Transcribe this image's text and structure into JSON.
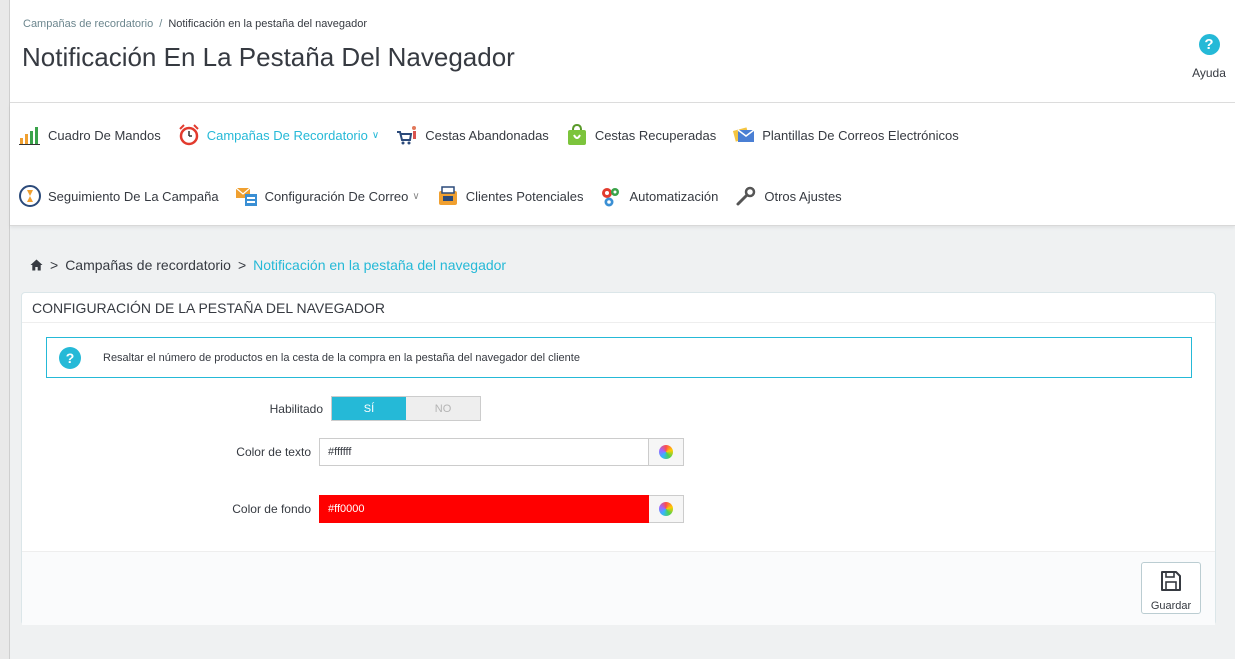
{
  "breadcrumb_top": {
    "parent": "Campañas de recordatorio",
    "separator": "/",
    "current": "Notificación en la pestaña del navegador"
  },
  "page_title": "Notificación En La Pestaña Del Navegador",
  "help": {
    "label": "Ayuda",
    "icon": "question-circle-icon",
    "glyph": "?"
  },
  "menu": {
    "row1": [
      {
        "label": "Cuadro De Mandos",
        "icon": "bar-chart-icon"
      },
      {
        "label": "Campañas De Recordatorio",
        "icon": "alarm-clock-icon",
        "active": true,
        "dropdown": true
      },
      {
        "label": "Cestas Abandonadas",
        "icon": "cart-person-icon"
      },
      {
        "label": "Cestas Recuperadas",
        "icon": "shopping-bag-icon"
      },
      {
        "label": "Plantillas De Correos Electrónicos",
        "icon": "email-templates-icon"
      }
    ],
    "row2": [
      {
        "label": "Seguimiento De La Campaña",
        "icon": "hourglass-icon"
      },
      {
        "label": "Configuración De Correo",
        "icon": "mail-server-icon",
        "dropdown": true
      },
      {
        "label": "Clientes Potenciales",
        "icon": "lead-box-icon"
      },
      {
        "label": "Automatización",
        "icon": "gears-icon"
      },
      {
        "label": "Otros Ajustes",
        "icon": "wrench-icon"
      }
    ],
    "chevron": "∨"
  },
  "crumb2": {
    "home_icon": "home-icon",
    "gt": ">",
    "parent": "Campañas de recordatorio",
    "current": "Notificación en la pestaña del navegador"
  },
  "panel": {
    "title": "CONFIGURACIÓN DE LA PESTAÑA DEL NAVEGADOR",
    "alert": "Resaltar el número de productos en la cesta de la compra en la pestaña del navegador del cliente",
    "alert_glyph": "?",
    "enabled_label": "Habilitado",
    "switch_on": "SÍ",
    "switch_off": "NO",
    "text_color_label": "Color de texto",
    "text_color_value": "#ffffff",
    "bg_color_label": "Color de fondo",
    "bg_color_value": "#ff0000",
    "save_label": "Guardar"
  },
  "colors": {
    "accent": "#25b9d7",
    "bg_swatch": "#ff0000"
  }
}
